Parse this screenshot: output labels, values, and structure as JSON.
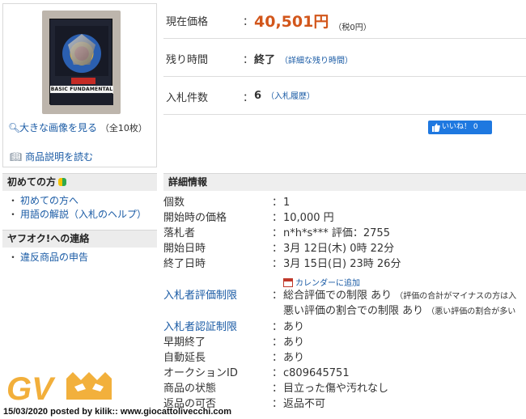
{
  "image_panel": {
    "product_image_text": "BASIC FUNDAMENTAL",
    "view_large_label": "大きな画像を見る",
    "image_count_note": "（全10枚）",
    "read_description_label": "商品説明を読む"
  },
  "sidebar": {
    "beginners_header": "初めての方",
    "beginners_items": [
      "初めての方へ",
      "用語の解説（入札のヘルプ）"
    ],
    "contact_header": "ヤフオク!への連絡",
    "contact_items": [
      "違反商品の申告"
    ]
  },
  "summary": {
    "price_label": "現在価格",
    "price_value": "40,501円",
    "price_tax_note": "（税0円）",
    "time_label": "残り時間",
    "time_value": "終了",
    "time_link": "（詳細な残り時間）",
    "bids_label": "入札件数",
    "bids_value": "6",
    "bids_link": "（入札履歴）",
    "like_label": "いいね！",
    "like_count": "0"
  },
  "details": {
    "header": "詳細情報",
    "colon": "：",
    "rows": [
      {
        "key": "個数",
        "value": "1"
      },
      {
        "key": "開始時の価格",
        "value": "10,000 円"
      },
      {
        "key": "落札者",
        "value": "n*h*s*** 評価：2755"
      },
      {
        "key": "開始日時",
        "value": "3月 12日(木) 0時 22分"
      },
      {
        "key": "終了日時",
        "value": "3月 15日(日) 23時 26分"
      }
    ],
    "calendar_link": "カレンダーに追加",
    "bidder_rating_label": "入札者評価制限",
    "bidder_rating_line1": "総合評価での制限 あり",
    "bidder_rating_line1_note": "（評価の合計がマイナスの方は入",
    "bidder_rating_line2": "悪い評価の割合での制限 あり",
    "bidder_rating_line2_note": "（悪い評価の割合が多い",
    "bidder_auth_label": "入札者認証制限",
    "rows2": [
      {
        "key": "早期終了",
        "value": "あり"
      },
      {
        "key": "自動延長",
        "value": "あり"
      },
      {
        "key": "オークションID",
        "value": "c809645751"
      },
      {
        "key": "商品の状態",
        "value": "目立った傷や汚れなし"
      },
      {
        "key": "返品の可否",
        "value": "返品不可"
      }
    ],
    "bidder_auth_value": "あり"
  },
  "watermark": {
    "logo_text": "GV",
    "caption": "15/03/2020 posted by kilik:: www.giocattolivecchi.com"
  },
  "colors": {
    "price": "#d2561b",
    "link": "#1a5ba5",
    "like_button": "#1e78e0",
    "watermark": "#f0a21a"
  }
}
